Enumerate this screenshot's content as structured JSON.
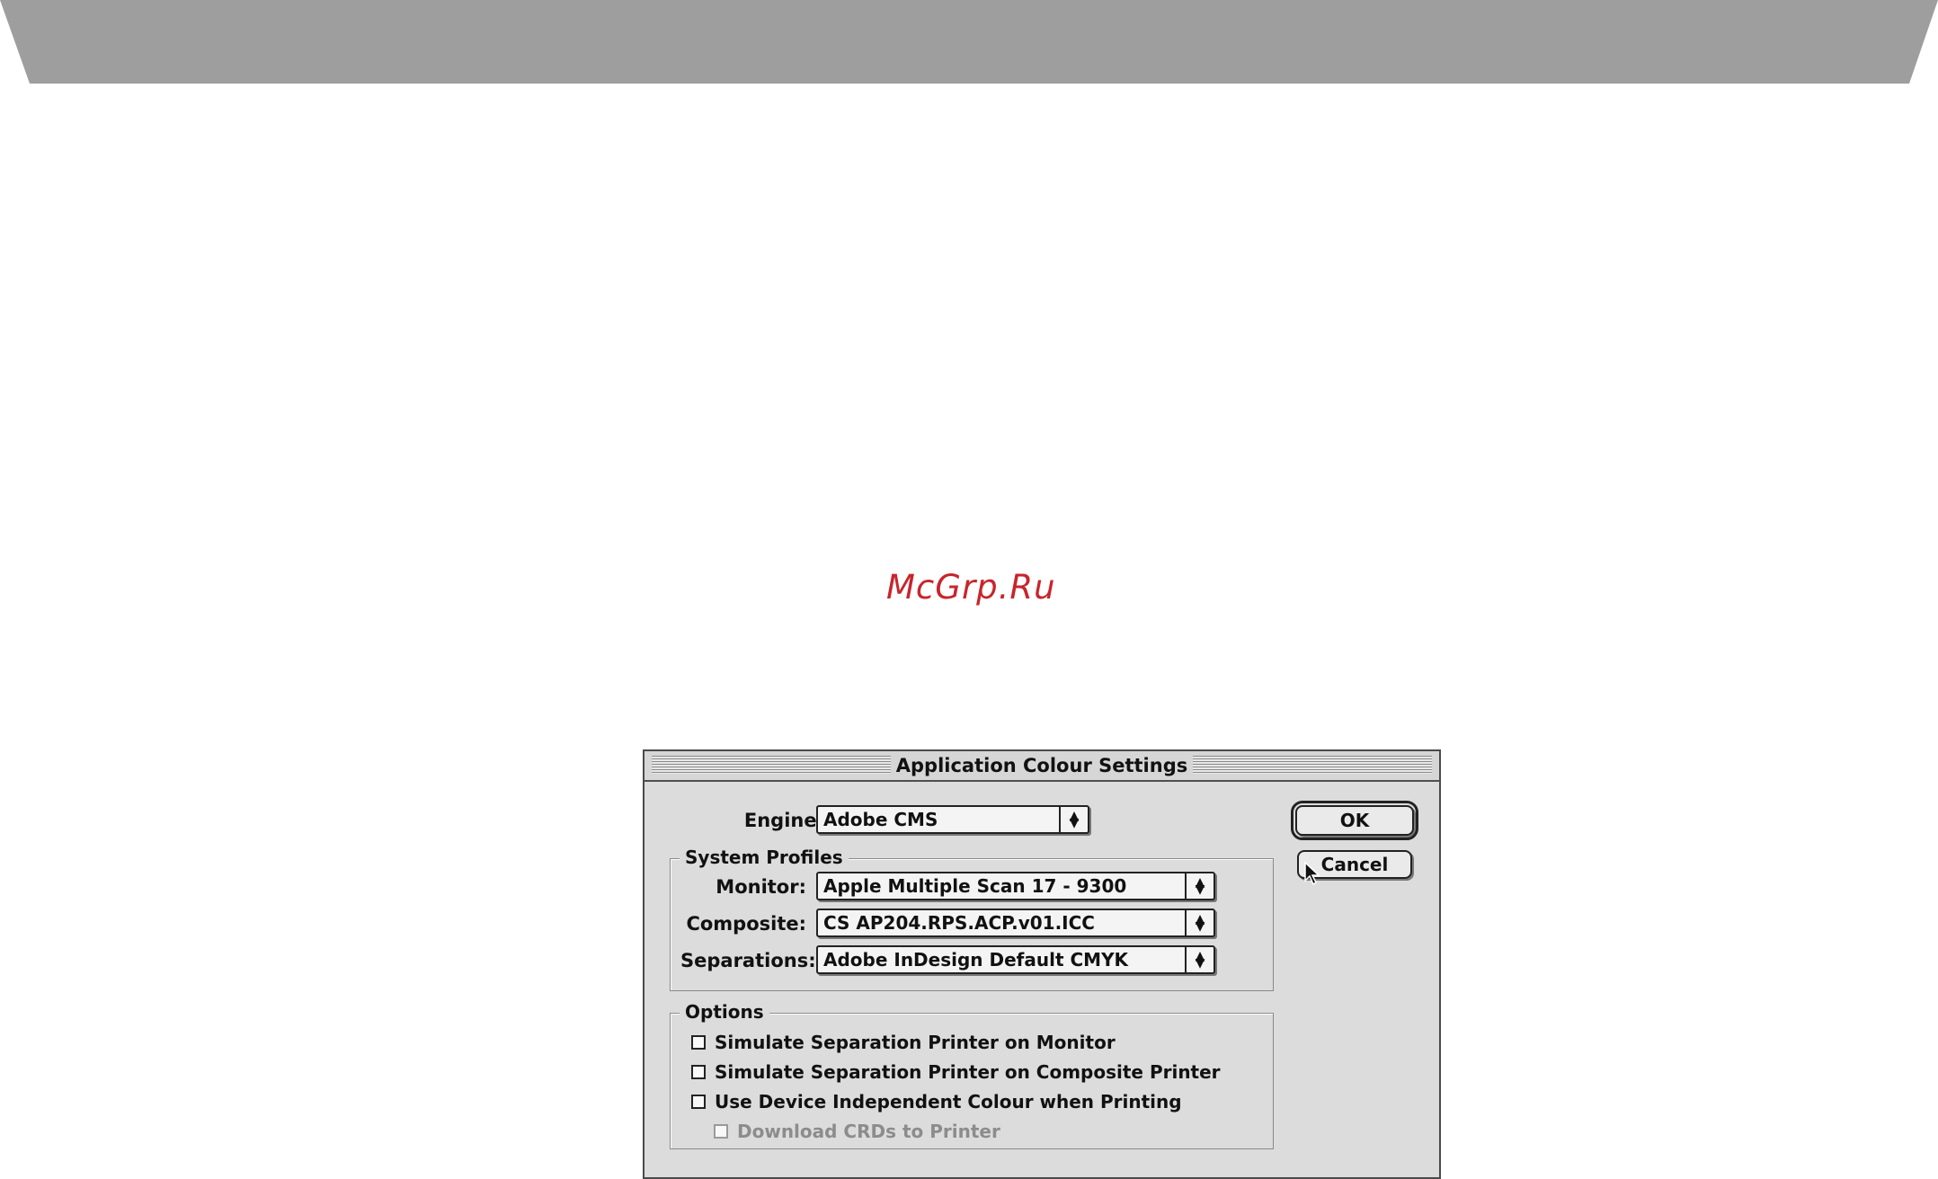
{
  "watermark": "McGrp.Ru",
  "dialog": {
    "title": "Application Colour Settings",
    "engine": {
      "label": "Engine:",
      "value": "Adobe CMS"
    },
    "system_profiles": {
      "title": "System Profiles",
      "monitor": {
        "label": "Monitor:",
        "value": "Apple Multiple Scan 17 - 9300"
      },
      "composite": {
        "label": "Composite:",
        "value": "CS AP204.RPS.ACP.v01.ICC"
      },
      "separations": {
        "label": "Separations:",
        "value": "Adobe InDesign Default CMYK"
      }
    },
    "options": {
      "title": "Options",
      "items": [
        {
          "label": "Simulate Separation Printer on Monitor",
          "checked": false,
          "enabled": true
        },
        {
          "label": "Simulate Separation Printer on Composite Printer",
          "checked": false,
          "enabled": true
        },
        {
          "label": "Use Device Independent Colour when Printing",
          "checked": false,
          "enabled": true
        },
        {
          "label": "Download CRDs to Printer",
          "checked": false,
          "enabled": false
        }
      ]
    },
    "buttons": {
      "ok": "OK",
      "cancel": "Cancel"
    }
  },
  "colors": {
    "banner": "#9e9e9e",
    "watermark": "#c8252c",
    "dialog_bg": "#dcdcdc"
  }
}
